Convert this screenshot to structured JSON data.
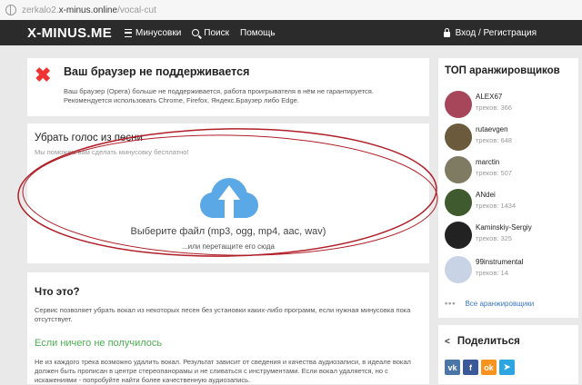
{
  "browser": {
    "url_prefix": "zerkalo2.",
    "url_host": "x-minus.online",
    "url_path": "/vocal-cut"
  },
  "header": {
    "logo": "X-MINUS.ME",
    "nav": [
      {
        "label": "Минусовки",
        "icon": "menu-icon"
      },
      {
        "label": "Поиск",
        "icon": "search-icon"
      },
      {
        "label": "Помощь"
      }
    ],
    "login": {
      "label": "Вход / Регистрация",
      "icon": "lock-icon"
    }
  },
  "warning": {
    "icon": "close-icon",
    "title": "Ваш браузер не поддерживается",
    "text": "Ваш браузер (Opera) больше не поддерживается, работа проигрывателя в нём не гарантируется. Рекомендуется использовать Chrome, Firefox, Яндекс.Браузер либо Edge."
  },
  "upload": {
    "title": "Убрать голос из песни",
    "subtitle": "Мы поможем вам сделать минусовку бесплатно!",
    "choose_label": "Выберите файл (mp3, ogg, mp4, aac, wav)",
    "drag_label": "...или перетащите его сюда",
    "icon": "cloud-upload-icon",
    "colors": {
      "cloud": "#5aa9e6",
      "arrow": "#ffffff",
      "annotation": "#b01e28"
    }
  },
  "about": {
    "title": "Что это?",
    "text1": "Сервис позволяет убрать вокал из некоторых песен без установки каких-либо программ, если нужная минусовка пока отсутствует.",
    "subtitle": "Если ничего не получилось",
    "text2": "Не из каждого трека возможно удалить вокал. Результат зависит от сведения и качества аудиозаписи, в идеале вокал должен быть прописан в центре стереопанорамы и не сливаться с инструментами. Если вокал удаляется, но с искажениями - попробуйте найти более качественную аудиозапись."
  },
  "top": {
    "title": "ТОП аранжировщиков",
    "arrangers": [
      {
        "name": "ALEX67",
        "tracks": "треков: 366",
        "avatar_color": "#a7455a"
      },
      {
        "name": "rutaevgen",
        "tracks": "треков: 648",
        "avatar_color": "#6b5a3c"
      },
      {
        "name": "marctin",
        "tracks": "треков: 507",
        "avatar_color": "#7f7a62"
      },
      {
        "name": "ANdei",
        "tracks": "треков: 1434",
        "avatar_color": "#3e5a2e"
      },
      {
        "name": "Kaminskiy-Sergiy",
        "tracks": "треков: 325",
        "avatar_color": "#222222"
      },
      {
        "name": "99instrumental",
        "tracks": "треков: 14",
        "avatar_color": "#c8d4e6"
      }
    ],
    "all_link": "Все аранжировщики"
  },
  "share": {
    "title": "Поделиться",
    "buttons": [
      {
        "label": "vk",
        "color": "#4a76a8",
        "glyph": "vk"
      },
      {
        "label": "facebook",
        "color": "#3b5998",
        "glyph": "f"
      },
      {
        "label": "odnoklassniki",
        "color": "#f7931e",
        "glyph": "ok"
      },
      {
        "label": "telegram",
        "color": "#2ca5e0",
        "glyph": "➤"
      }
    ]
  }
}
